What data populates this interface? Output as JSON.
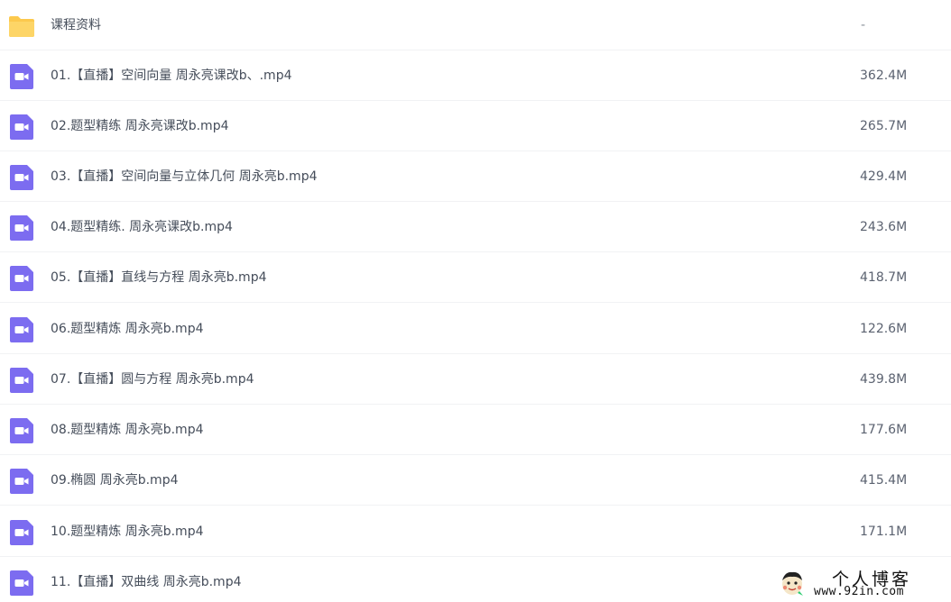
{
  "colors": {
    "video_icon": "#7c6cf0",
    "folder_icon": "#fcc94d",
    "row_divider": "#f1f2f4",
    "text": "#454d5a"
  },
  "files": [
    {
      "name": "课程资料",
      "size": "-",
      "type": "folder",
      "icon": "folder-icon"
    },
    {
      "name": "01.【直播】空间向量 周永亮课改b、.mp4",
      "size": "362.4M",
      "type": "video",
      "icon": "video-file-icon"
    },
    {
      "name": "02.题型精练 周永亮课改b.mp4",
      "size": "265.7M",
      "type": "video",
      "icon": "video-file-icon"
    },
    {
      "name": "03.【直播】空间向量与立体几何 周永亮b.mp4",
      "size": "429.4M",
      "type": "video",
      "icon": "video-file-icon"
    },
    {
      "name": "04.题型精练. 周永亮课改b.mp4",
      "size": "243.6M",
      "type": "video",
      "icon": "video-file-icon"
    },
    {
      "name": "05.【直播】直线与方程 周永亮b.mp4",
      "size": "418.7M",
      "type": "video",
      "icon": "video-file-icon"
    },
    {
      "name": "06.题型精炼 周永亮b.mp4",
      "size": "122.6M",
      "type": "video",
      "icon": "video-file-icon"
    },
    {
      "name": "07.【直播】圆与方程 周永亮b.mp4",
      "size": "439.8M",
      "type": "video",
      "icon": "video-file-icon"
    },
    {
      "name": "08.题型精炼 周永亮b.mp4",
      "size": "177.6M",
      "type": "video",
      "icon": "video-file-icon"
    },
    {
      "name": "09.椭圆 周永亮b.mp4",
      "size": "415.4M",
      "type": "video",
      "icon": "video-file-icon"
    },
    {
      "name": "10.题型精炼 周永亮b.mp4",
      "size": "171.1M",
      "type": "video",
      "icon": "video-file-icon"
    },
    {
      "name": "11.【直播】双曲线 周永亮b.mp4",
      "size": "",
      "type": "video",
      "icon": "video-file-icon"
    }
  ],
  "watermark": {
    "title": "个人博客",
    "url": "www.92in.com",
    "icon": "mascot-logo"
  }
}
